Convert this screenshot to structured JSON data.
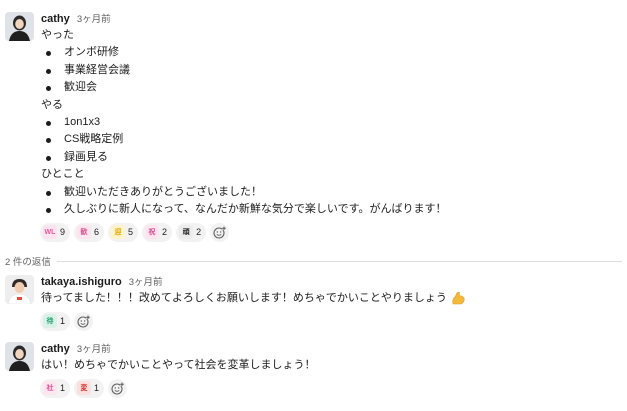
{
  "messages": [
    {
      "author": "cathy",
      "time": "3ヶ月前",
      "lines": {
        "h1": "やった",
        "b1": "オンボ研修",
        "b2": "事業経営会議",
        "b3": "歓迎会",
        "h2": "やる",
        "b4": "1on1x3",
        "b5": "CS戦略定例",
        "b6": "録画見る",
        "h3": "ひとこと",
        "b7": "歓迎いただきありがとうございました！",
        "b8": "久しぶりに新人になって、なんだか新鮮な気分で楽しいです。がんばります！"
      },
      "reactions": [
        {
          "icon": "welcome-emoji",
          "count": "9",
          "color": "#f0a3c8"
        },
        {
          "icon": "pink-text-emoji",
          "count": "6",
          "color": "#ec6fa4"
        },
        {
          "icon": "yellow-text-emoji",
          "count": "5",
          "color": "#f3c443"
        },
        {
          "icon": "pink-text-emoji-2",
          "count": "2",
          "color": "#e86da9"
        },
        {
          "icon": "black-text-emoji",
          "count": "2",
          "color": "#333333"
        }
      ]
    },
    {
      "author": "takaya.ishiguro",
      "time": "3ヶ月前",
      "text": "待ってました！！！改めてよろしくお願いします！めちゃでかいことやりましょう",
      "inline_emoji": "muscle-emoji",
      "reactions": [
        {
          "icon": "green-text-emoji",
          "count": "1",
          "color": "#39b58a"
        }
      ]
    },
    {
      "author": "cathy",
      "time": "3ヶ月前",
      "text": "はい！めちゃでかいことやって社会を変革しましょう！",
      "reactions": [
        {
          "icon": "pink-text-emoji-3",
          "count": "1",
          "color": "#e86da9"
        },
        {
          "icon": "red-text-emoji",
          "count": "1",
          "color": "#d9534f"
        }
      ]
    }
  ],
  "replies_divider": "2 件の返信",
  "colors": {
    "text": "#1d1c1d",
    "muted": "#616061",
    "pill_bg": "#f2f2f2",
    "divider": "#dddddd"
  }
}
